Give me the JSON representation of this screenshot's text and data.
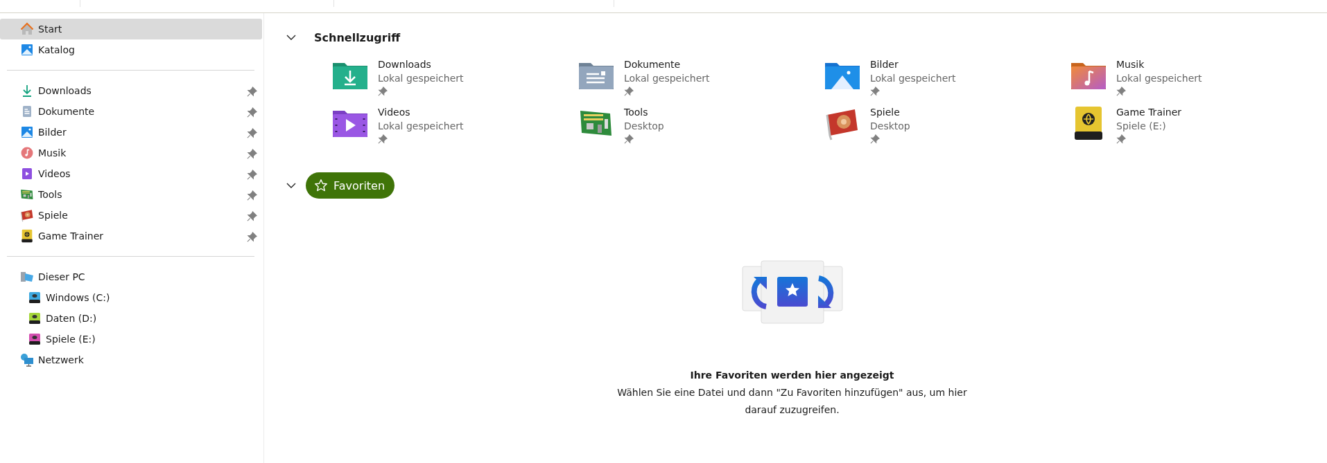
{
  "sidebar": {
    "top_items": [
      {
        "label": "Start",
        "kind": "home",
        "selected": true
      },
      {
        "label": "Katalog",
        "kind": "catalog",
        "selected": false
      }
    ],
    "pinned_items": [
      {
        "label": "Downloads",
        "kind": "downloads",
        "selected": false,
        "pinned": true
      },
      {
        "label": "Dokumente",
        "kind": "documents",
        "selected": false,
        "pinned": true
      },
      {
        "label": "Bilder",
        "kind": "pictures",
        "selected": false,
        "pinned": true
      },
      {
        "label": "Musik",
        "kind": "music",
        "selected": false,
        "pinned": true
      },
      {
        "label": "Videos",
        "kind": "videos",
        "selected": false,
        "pinned": true
      },
      {
        "label": "Tools",
        "kind": "tools",
        "selected": false,
        "pinned": true
      },
      {
        "label": "Spiele",
        "kind": "games",
        "selected": false,
        "pinned": true
      },
      {
        "label": "Game Trainer",
        "kind": "trainer",
        "selected": false,
        "pinned": true
      }
    ],
    "locations": [
      {
        "label": "Dieser PC",
        "kind": "pc",
        "selected": false,
        "children": [
          {
            "label": "Windows (C:)",
            "kind": "drive",
            "color": "#3fa9e0",
            "selected": false
          },
          {
            "label": "Daten (D:)",
            "kind": "drive",
            "color": "#a6d63a",
            "selected": false
          },
          {
            "label": "Spiele (E:)",
            "kind": "drive",
            "color": "#d44fb0",
            "selected": false
          }
        ]
      },
      {
        "label": "Netzwerk",
        "kind": "network",
        "selected": false
      }
    ]
  },
  "quick_access": {
    "title": "Schnellzugriff",
    "expanded": true,
    "items": [
      {
        "name": "Downloads",
        "location": "Lokal gespeichert",
        "kind": "downloads",
        "pinned": true
      },
      {
        "name": "Dokumente",
        "location": "Lokal gespeichert",
        "kind": "documents",
        "pinned": true
      },
      {
        "name": "Bilder",
        "location": "Lokal gespeichert",
        "kind": "pictures",
        "pinned": true
      },
      {
        "name": "Musik",
        "location": "Lokal gespeichert",
        "kind": "music",
        "pinned": true
      },
      {
        "name": "Videos",
        "location": "Lokal gespeichert",
        "kind": "videos",
        "pinned": true
      },
      {
        "name": "Tools",
        "location": "Desktop",
        "kind": "tools",
        "pinned": true
      },
      {
        "name": "Spiele",
        "location": "Desktop",
        "kind": "games",
        "pinned": true
      },
      {
        "name": "Game Trainer",
        "location": "Spiele (E:)",
        "kind": "trainer",
        "pinned": true
      }
    ]
  },
  "favorites": {
    "title": "Favoriten",
    "expanded": true,
    "empty_title": "Ihre Favoriten werden hier angezeigt",
    "empty_text": "Wählen Sie eine Datei und dann \"Zu Favoriten hinzufügen\" aus, um hier darauf zuzugreifen."
  }
}
